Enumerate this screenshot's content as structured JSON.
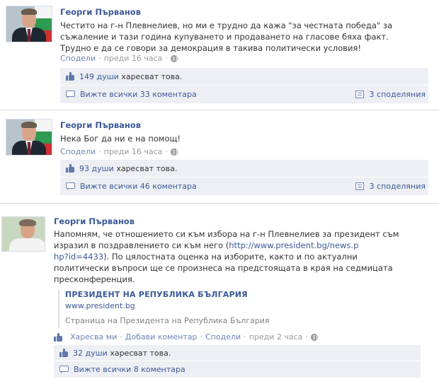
{
  "posts": [
    {
      "author": "Георги Първанов",
      "text_lines": [
        "Честито на г-н Плевнелиев, но ми е трудно да кажа \"за честната победа\" за",
        "съжаление и тази година купуването и продаването на гласове бяха факт.",
        "Трудно е да се говори за демокрация в такива политически условия!"
      ],
      "share_link": "Сподели",
      "time": "преди 16 часа",
      "likes": "149 души",
      "likes_suffix": "харесват това.",
      "view_comments": "Вижте всички 33 коментара",
      "shares": "3 споделяния"
    },
    {
      "author": "Георги Първанов",
      "text_lines": [
        "Нека Бог да ни е на помощ!"
      ],
      "share_link": "Сподели",
      "time": "преди 16 часа",
      "likes": "93 души",
      "likes_suffix": "харесват това.",
      "view_comments": "Вижте всички 46 коментара",
      "shares": "3 споделяния"
    },
    {
      "author": "Георги Първанов",
      "text_parts": {
        "line1": "Напомням, че отношението си към избора на г-н Плевнелиев за президент съм",
        "line2_before": "изразил в поздравлението си към него (",
        "link_part1": "http://www.president.bg/news.p",
        "link_part2": "hp?id=4433",
        "line3_after": "). По цялостната оценка на изборите, както и по актуални",
        "line4": "политически въпроси ще се произнеса на предстоящата в края на седмицата",
        "line5": "пресконференция."
      },
      "attachment": {
        "title": "ПРЕЗИДЕНТ НА РЕПУБЛИКА БЪЛГАРИЯ",
        "url": "www.president.bg",
        "description": "Страница на Президента на Република България"
      },
      "actions": {
        "like": "Харесва ми",
        "comment": "Добави коментар",
        "share": "Сподели",
        "time": "преди 2 часа"
      },
      "likes": "32 души",
      "likes_suffix": "харесват това.",
      "view_comments": "Вижте всички 8 коментара"
    }
  ],
  "separator": "·",
  "icons": {
    "like": "thumbs-up-icon",
    "comment": "comment-bubble-icon",
    "share": "share-page-icon",
    "privacy": "globe-icon"
  },
  "colors": {
    "link": "#3b5998",
    "meta": "#999999",
    "ufi_bg": "#edeff4"
  }
}
